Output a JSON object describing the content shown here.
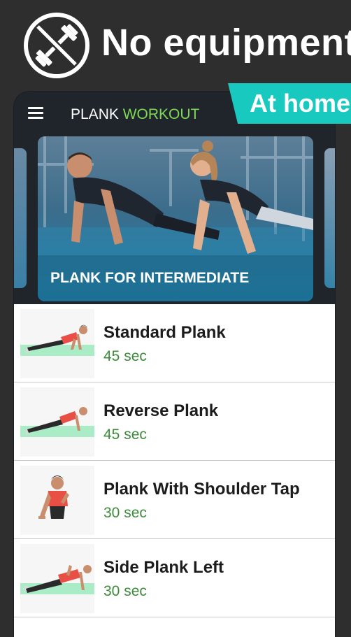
{
  "promo": {
    "icon": "no-dumbbell-icon",
    "title": "No equipment",
    "badge": "At home"
  },
  "appbar": {
    "menu_icon": "hamburger-menu-icon",
    "title_main": "PLANK",
    "title_accent": "WORKOUT"
  },
  "carousel": {
    "featured_label": "PLANK FOR INTERMEDIATE"
  },
  "exercises": [
    {
      "name": "Standard Plank",
      "duration": "45 sec",
      "icon": "standard-plank-illustration"
    },
    {
      "name": "Reverse Plank",
      "duration": "45 sec",
      "icon": "reverse-plank-illustration"
    },
    {
      "name": "Plank With Shoulder Tap",
      "duration": "30 sec",
      "icon": "shoulder-tap-illustration"
    },
    {
      "name": "Side Plank Left",
      "duration": "30 sec",
      "icon": "side-plank-illustration"
    }
  ],
  "colors": {
    "accent_green": "#7ed957",
    "duration_green": "#3c8c3a",
    "badge_teal": "#18c9c0",
    "app_bg": "#1f252b",
    "page_bg": "#2e2e2e"
  }
}
